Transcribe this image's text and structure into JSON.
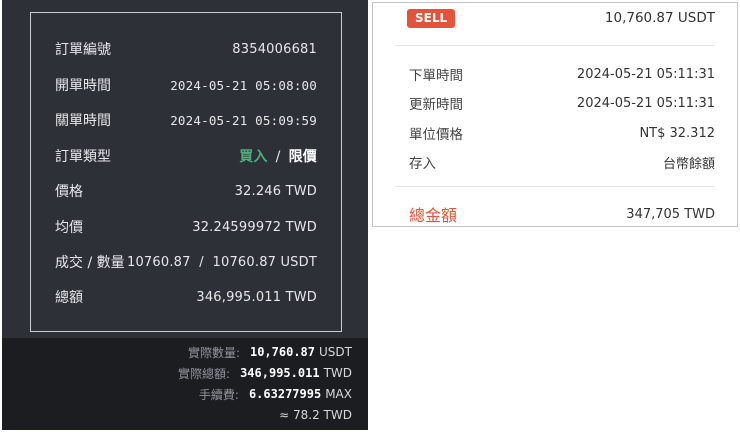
{
  "left": {
    "rows": [
      {
        "label": "訂單編號",
        "value": "8354006681"
      },
      {
        "label": "開單時間",
        "value": "2024-05-21 05:08:00"
      },
      {
        "label": "關單時間",
        "value": "2024-05-21 05:09:59"
      },
      {
        "label": "訂單類型",
        "buy": "買入",
        "slash": "/",
        "limit": "限價"
      },
      {
        "label": "價格",
        "value": "32.246 TWD"
      },
      {
        "label": "均價",
        "value": "32.24599972 TWD"
      },
      {
        "label": "成交 / 數量",
        "value": "10760.87  /  10760.87 USDT"
      },
      {
        "label": "總額",
        "value": "346,995.011 TWD"
      }
    ],
    "footer": {
      "actual_qty_label": "實際數量:",
      "actual_qty_value": "10,760.87",
      "actual_qty_unit": "USDT",
      "actual_total_label": "實際總額:",
      "actual_total_value": "346,995.011",
      "actual_total_unit": "TWD",
      "fee_label": "手續費:",
      "fee_value": "6.63277995",
      "fee_unit": "MAX",
      "fee_approx": "≈ 78.2 TWD"
    }
  },
  "right": {
    "side_badge": "SELL",
    "side_amount": "10,760.87 USDT",
    "rows": [
      {
        "label": "下單時間",
        "value": "2024-05-21 05:11:31"
      },
      {
        "label": "更新時間",
        "value": "2024-05-21 05:11:31"
      },
      {
        "label": "單位價格",
        "value": "NT$ 32.312"
      },
      {
        "label": "存入",
        "value": "台幣餘額"
      }
    ],
    "total_label": "總金額",
    "total_value": "347,705 TWD"
  },
  "colors": {
    "buy": "#4caf7a",
    "sell": "#e5533a",
    "dark_bg": "#2d3137",
    "footer_bg": "#1b1d21"
  }
}
